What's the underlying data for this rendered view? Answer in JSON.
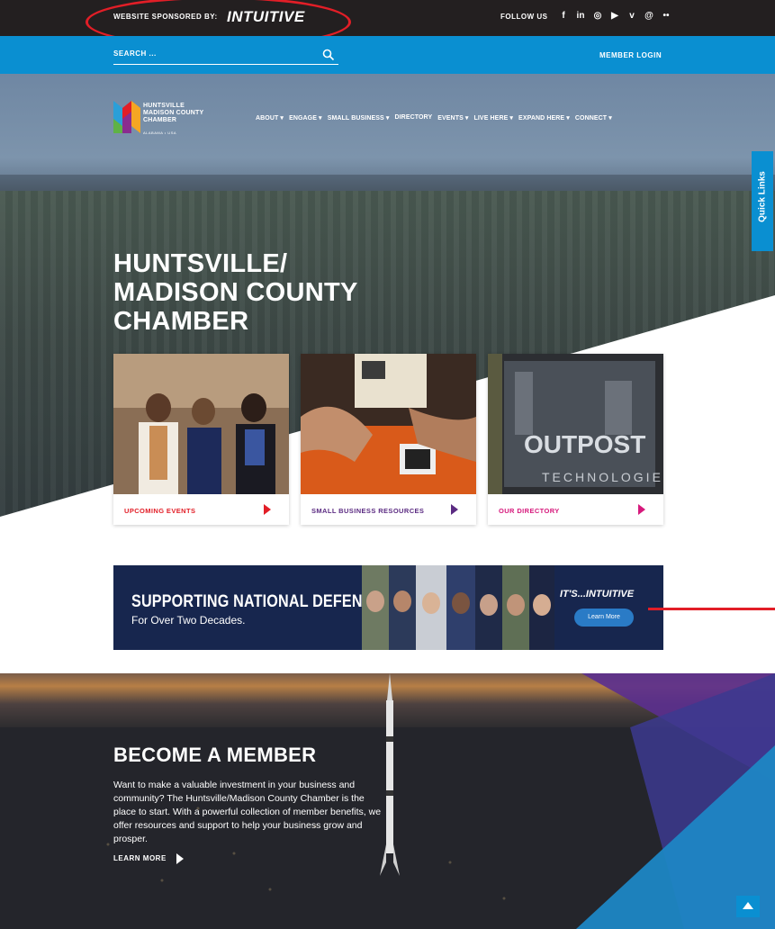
{
  "topbar": {
    "sponsor_label": "WEBSITE SPONSORED BY:",
    "sponsor_logo": "INTUITIVE",
    "follow_label": "FOLLOW US",
    "socials": [
      "facebook-icon",
      "linkedin-icon",
      "instagram-icon",
      "youtube-icon",
      "vimeo-icon",
      "threads-icon",
      "flickr-icon"
    ]
  },
  "searchbar": {
    "search_placeholder": "SEARCH ...",
    "member_login": "MEMBER LOGIN"
  },
  "header": {
    "logo_lines": [
      "HUNTSVILLE",
      "MADISON COUNTY",
      "CHAMBER"
    ],
    "logo_sub": "ALABAMA • USA",
    "nav": [
      "ABOUT",
      "ENGAGE",
      "SMALL BUSINESS",
      "DIRECTORY",
      "EVENTS",
      "LIVE HERE",
      "EXPAND HERE",
      "CONNECT"
    ]
  },
  "hero": {
    "title_line1": "HUNTSVILLE/",
    "title_line2": "MADISON COUNTY",
    "title_line3": "CHAMBER"
  },
  "quick_links": "Quick Links",
  "cards": [
    {
      "label": "UPCOMING EVENTS",
      "color": "#e21e27"
    },
    {
      "label": "SMALL BUSINESS RESOURCES",
      "color": "#5b2b82"
    },
    {
      "label": "OUR DIRECTORY",
      "color": "#d6197c"
    }
  ],
  "banner": {
    "title": "SUPPORTING NATIONAL DEFENSE",
    "subtitle": "For Over Two Decades.",
    "brand": "IT'S...INTUITIVE",
    "button": "Learn More"
  },
  "member": {
    "title": "BECOME A MEMBER",
    "body": "Want to make a valuable investment in your business and community? The Huntsville/Madison County Chamber is the place to start. With a powerful collection of member benefits, we offer resources and support to help your business grow and prosper.",
    "learn_more": "LEARN MORE"
  },
  "colors": {
    "accent_blue": "#0a8fd1",
    "dark": "#231f20",
    "annotation_red": "#e21e27"
  }
}
